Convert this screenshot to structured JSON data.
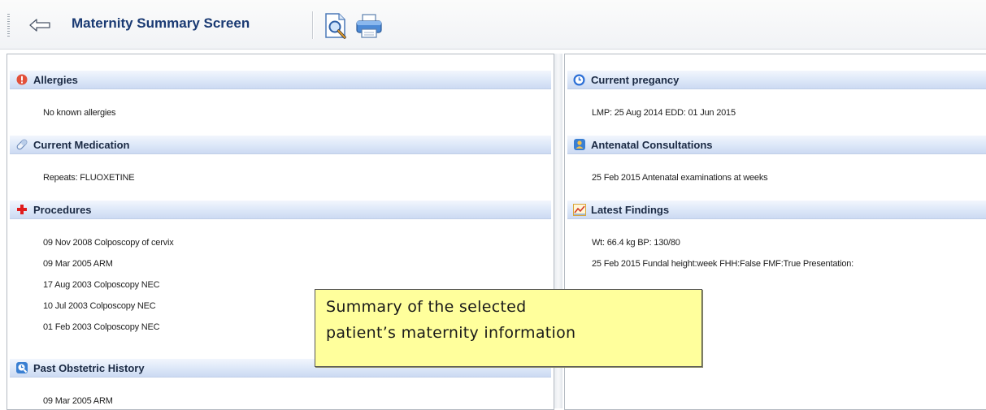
{
  "toolbar": {
    "title": "Maternity Summary Screen",
    "back_icon": "arrow-left-icon",
    "preview_icon": "print-preview-icon",
    "print_icon": "printer-icon"
  },
  "left_panel": {
    "allergies": {
      "title": "Allergies",
      "icon": "alert-icon",
      "items": [
        "No known allergies"
      ]
    },
    "medication": {
      "title": "Current Medication",
      "icon": "pill-icon",
      "items": [
        "Repeats: FLUOXETINE"
      ]
    },
    "procedures": {
      "title": "Procedures",
      "icon": "red-cross-icon",
      "items": [
        "09 Nov 2008  Colposcopy of cervix",
        "09 Mar 2005  ARM",
        "17 Aug 2003  Colposcopy NEC",
        "10 Jul 2003  Colposcopy NEC",
        "01 Feb 2003  Colposcopy NEC"
      ]
    },
    "obstetric": {
      "title": "Past Obstetric History",
      "icon": "history-icon",
      "items": [
        "09 Mar 2005  ARM"
      ]
    }
  },
  "right_panel": {
    "pregnancy": {
      "title": "Current pregancy",
      "icon": "clock-icon",
      "items": [
        "LMP: 25 Aug 2014  EDD: 01 Jun 2015"
      ]
    },
    "consultations": {
      "title": "Antenatal Consultations",
      "icon": "consultation-icon",
      "items": [
        "25 Feb 2015  Antenatal examinations at  weeks"
      ]
    },
    "findings": {
      "title": "Latest Findings",
      "icon": "chart-icon",
      "items": [
        "Wt: 66.4 kg BP: 130/80",
        "25 Feb 2015  Fundal height:week  FHH:False  FMF:True  Presentation:"
      ]
    }
  },
  "callout": {
    "line1": "Summary of the selected",
    "line2": "patient’s maternity information"
  },
  "colors": {
    "title_text": "#1a3a73",
    "section_header": "#dce7f8",
    "callout_bg": "#ffff9c",
    "allergy_icon": "#e2503a",
    "cross_icon": "#e01b1b",
    "clock_icon": "#2c6fd6"
  }
}
